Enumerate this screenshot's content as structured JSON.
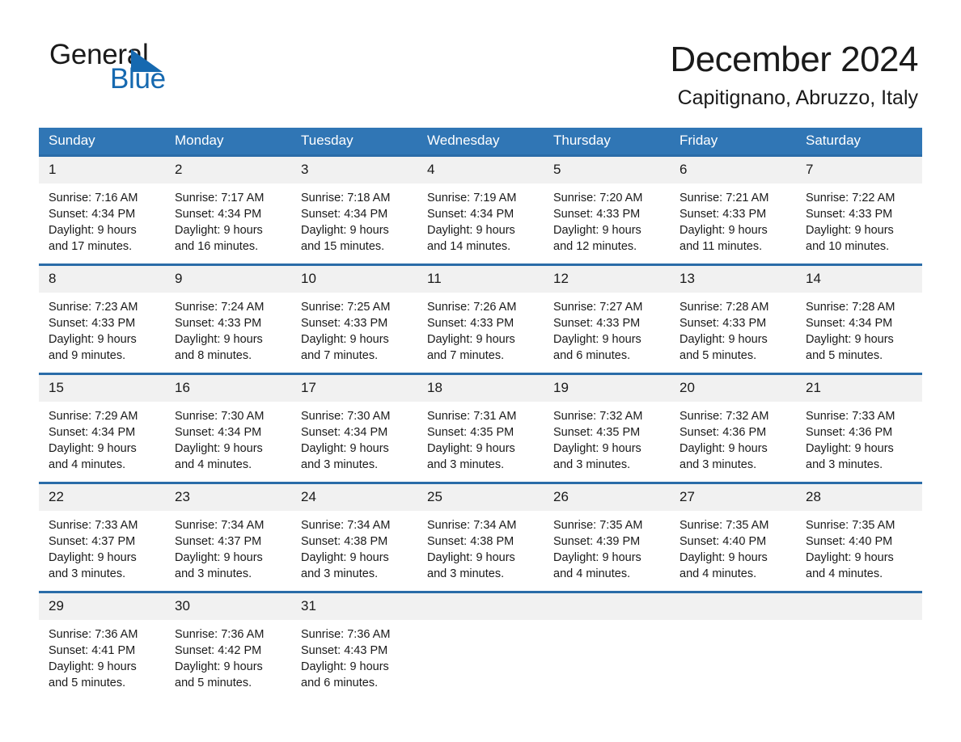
{
  "logo": {
    "word_one": "General",
    "word_two": "Blue",
    "flag_icon": "triangle-flag-icon",
    "brand_color": "#1669b0"
  },
  "header": {
    "title": "December 2024",
    "subtitle": "Capitignano, Abruzzo, Italy"
  },
  "theme": {
    "header_blue": "#3076b5",
    "row_border_blue": "#2a6ca8",
    "daynum_band": "#f1f1f1",
    "text": "#1a1a1a"
  },
  "weekdays": [
    "Sunday",
    "Monday",
    "Tuesday",
    "Wednesday",
    "Thursday",
    "Friday",
    "Saturday"
  ],
  "weeks": [
    [
      {
        "day": "1",
        "sunrise": "Sunrise: 7:16 AM",
        "sunset": "Sunset: 4:34 PM",
        "daylight_line1": "Daylight: 9 hours",
        "daylight_line2": "and 17 minutes."
      },
      {
        "day": "2",
        "sunrise": "Sunrise: 7:17 AM",
        "sunset": "Sunset: 4:34 PM",
        "daylight_line1": "Daylight: 9 hours",
        "daylight_line2": "and 16 minutes."
      },
      {
        "day": "3",
        "sunrise": "Sunrise: 7:18 AM",
        "sunset": "Sunset: 4:34 PM",
        "daylight_line1": "Daylight: 9 hours",
        "daylight_line2": "and 15 minutes."
      },
      {
        "day": "4",
        "sunrise": "Sunrise: 7:19 AM",
        "sunset": "Sunset: 4:34 PM",
        "daylight_line1": "Daylight: 9 hours",
        "daylight_line2": "and 14 minutes."
      },
      {
        "day": "5",
        "sunrise": "Sunrise: 7:20 AM",
        "sunset": "Sunset: 4:33 PM",
        "daylight_line1": "Daylight: 9 hours",
        "daylight_line2": "and 12 minutes."
      },
      {
        "day": "6",
        "sunrise": "Sunrise: 7:21 AM",
        "sunset": "Sunset: 4:33 PM",
        "daylight_line1": "Daylight: 9 hours",
        "daylight_line2": "and 11 minutes."
      },
      {
        "day": "7",
        "sunrise": "Sunrise: 7:22 AM",
        "sunset": "Sunset: 4:33 PM",
        "daylight_line1": "Daylight: 9 hours",
        "daylight_line2": "and 10 minutes."
      }
    ],
    [
      {
        "day": "8",
        "sunrise": "Sunrise: 7:23 AM",
        "sunset": "Sunset: 4:33 PM",
        "daylight_line1": "Daylight: 9 hours",
        "daylight_line2": "and 9 minutes."
      },
      {
        "day": "9",
        "sunrise": "Sunrise: 7:24 AM",
        "sunset": "Sunset: 4:33 PM",
        "daylight_line1": "Daylight: 9 hours",
        "daylight_line2": "and 8 minutes."
      },
      {
        "day": "10",
        "sunrise": "Sunrise: 7:25 AM",
        "sunset": "Sunset: 4:33 PM",
        "daylight_line1": "Daylight: 9 hours",
        "daylight_line2": "and 7 minutes."
      },
      {
        "day": "11",
        "sunrise": "Sunrise: 7:26 AM",
        "sunset": "Sunset: 4:33 PM",
        "daylight_line1": "Daylight: 9 hours",
        "daylight_line2": "and 7 minutes."
      },
      {
        "day": "12",
        "sunrise": "Sunrise: 7:27 AM",
        "sunset": "Sunset: 4:33 PM",
        "daylight_line1": "Daylight: 9 hours",
        "daylight_line2": "and 6 minutes."
      },
      {
        "day": "13",
        "sunrise": "Sunrise: 7:28 AM",
        "sunset": "Sunset: 4:33 PM",
        "daylight_line1": "Daylight: 9 hours",
        "daylight_line2": "and 5 minutes."
      },
      {
        "day": "14",
        "sunrise": "Sunrise: 7:28 AM",
        "sunset": "Sunset: 4:34 PM",
        "daylight_line1": "Daylight: 9 hours",
        "daylight_line2": "and 5 minutes."
      }
    ],
    [
      {
        "day": "15",
        "sunrise": "Sunrise: 7:29 AM",
        "sunset": "Sunset: 4:34 PM",
        "daylight_line1": "Daylight: 9 hours",
        "daylight_line2": "and 4 minutes."
      },
      {
        "day": "16",
        "sunrise": "Sunrise: 7:30 AM",
        "sunset": "Sunset: 4:34 PM",
        "daylight_line1": "Daylight: 9 hours",
        "daylight_line2": "and 4 minutes."
      },
      {
        "day": "17",
        "sunrise": "Sunrise: 7:30 AM",
        "sunset": "Sunset: 4:34 PM",
        "daylight_line1": "Daylight: 9 hours",
        "daylight_line2": "and 3 minutes."
      },
      {
        "day": "18",
        "sunrise": "Sunrise: 7:31 AM",
        "sunset": "Sunset: 4:35 PM",
        "daylight_line1": "Daylight: 9 hours",
        "daylight_line2": "and 3 minutes."
      },
      {
        "day": "19",
        "sunrise": "Sunrise: 7:32 AM",
        "sunset": "Sunset: 4:35 PM",
        "daylight_line1": "Daylight: 9 hours",
        "daylight_line2": "and 3 minutes."
      },
      {
        "day": "20",
        "sunrise": "Sunrise: 7:32 AM",
        "sunset": "Sunset: 4:36 PM",
        "daylight_line1": "Daylight: 9 hours",
        "daylight_line2": "and 3 minutes."
      },
      {
        "day": "21",
        "sunrise": "Sunrise: 7:33 AM",
        "sunset": "Sunset: 4:36 PM",
        "daylight_line1": "Daylight: 9 hours",
        "daylight_line2": "and 3 minutes."
      }
    ],
    [
      {
        "day": "22",
        "sunrise": "Sunrise: 7:33 AM",
        "sunset": "Sunset: 4:37 PM",
        "daylight_line1": "Daylight: 9 hours",
        "daylight_line2": "and 3 minutes."
      },
      {
        "day": "23",
        "sunrise": "Sunrise: 7:34 AM",
        "sunset": "Sunset: 4:37 PM",
        "daylight_line1": "Daylight: 9 hours",
        "daylight_line2": "and 3 minutes."
      },
      {
        "day": "24",
        "sunrise": "Sunrise: 7:34 AM",
        "sunset": "Sunset: 4:38 PM",
        "daylight_line1": "Daylight: 9 hours",
        "daylight_line2": "and 3 minutes."
      },
      {
        "day": "25",
        "sunrise": "Sunrise: 7:34 AM",
        "sunset": "Sunset: 4:38 PM",
        "daylight_line1": "Daylight: 9 hours",
        "daylight_line2": "and 3 minutes."
      },
      {
        "day": "26",
        "sunrise": "Sunrise: 7:35 AM",
        "sunset": "Sunset: 4:39 PM",
        "daylight_line1": "Daylight: 9 hours",
        "daylight_line2": "and 4 minutes."
      },
      {
        "day": "27",
        "sunrise": "Sunrise: 7:35 AM",
        "sunset": "Sunset: 4:40 PM",
        "daylight_line1": "Daylight: 9 hours",
        "daylight_line2": "and 4 minutes."
      },
      {
        "day": "28",
        "sunrise": "Sunrise: 7:35 AM",
        "sunset": "Sunset: 4:40 PM",
        "daylight_line1": "Daylight: 9 hours",
        "daylight_line2": "and 4 minutes."
      }
    ],
    [
      {
        "day": "29",
        "sunrise": "Sunrise: 7:36 AM",
        "sunset": "Sunset: 4:41 PM",
        "daylight_line1": "Daylight: 9 hours",
        "daylight_line2": "and 5 minutes."
      },
      {
        "day": "30",
        "sunrise": "Sunrise: 7:36 AM",
        "sunset": "Sunset: 4:42 PM",
        "daylight_line1": "Daylight: 9 hours",
        "daylight_line2": "and 5 minutes."
      },
      {
        "day": "31",
        "sunrise": "Sunrise: 7:36 AM",
        "sunset": "Sunset: 4:43 PM",
        "daylight_line1": "Daylight: 9 hours",
        "daylight_line2": "and 6 minutes."
      },
      {
        "day": "",
        "sunrise": "",
        "sunset": "",
        "daylight_line1": "",
        "daylight_line2": ""
      },
      {
        "day": "",
        "sunrise": "",
        "sunset": "",
        "daylight_line1": "",
        "daylight_line2": ""
      },
      {
        "day": "",
        "sunrise": "",
        "sunset": "",
        "daylight_line1": "",
        "daylight_line2": ""
      },
      {
        "day": "",
        "sunrise": "",
        "sunset": "",
        "daylight_line1": "",
        "daylight_line2": ""
      }
    ]
  ]
}
